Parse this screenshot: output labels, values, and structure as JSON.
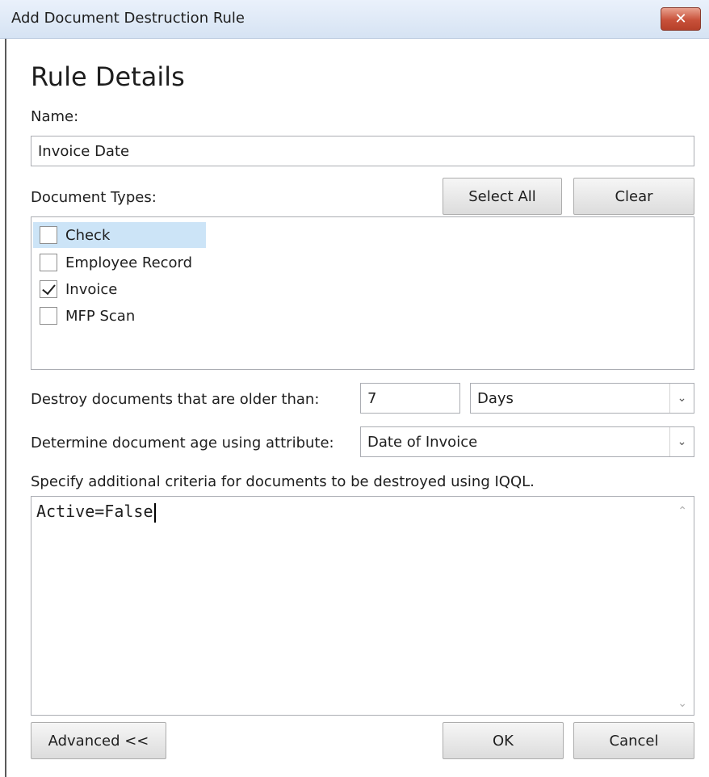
{
  "window": {
    "title": "Add Document Destruction Rule",
    "close_label": "✕"
  },
  "heading": "Rule Details",
  "name": {
    "label": "Name:",
    "value": "Invoice Date"
  },
  "document_types": {
    "label": "Document Types:",
    "select_all_label": "Select All",
    "clear_label": "Clear",
    "items": [
      {
        "label": "Check",
        "checked": false,
        "selected": true
      },
      {
        "label": "Employee Record",
        "checked": false,
        "selected": false
      },
      {
        "label": "Invoice",
        "checked": true,
        "selected": false
      },
      {
        "label": "MFP Scan",
        "checked": false,
        "selected": false
      }
    ]
  },
  "destroy_older": {
    "label": "Destroy documents that are older than:",
    "value": "7",
    "unit": "Days"
  },
  "age_attribute": {
    "label": "Determine document age using attribute:",
    "value": "Date of Invoice"
  },
  "criteria": {
    "label": "Specify additional criteria for documents to be destroyed using IQQL.",
    "value": "Active=False"
  },
  "footer": {
    "advanced_label": "Advanced <<",
    "ok_label": "OK",
    "cancel_label": "Cancel"
  }
}
